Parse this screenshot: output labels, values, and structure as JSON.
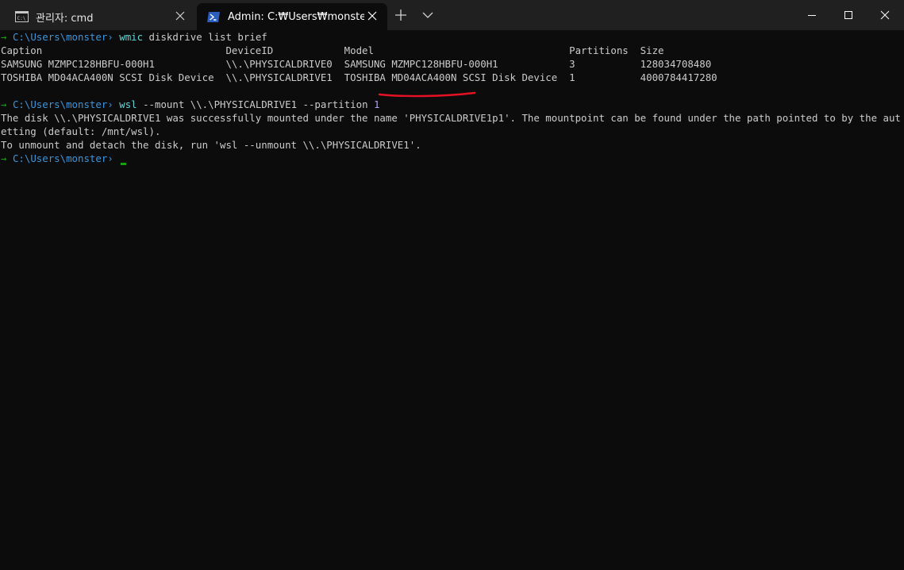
{
  "tabs": [
    {
      "title": "관리자: cmd",
      "icon": "cmd-icon",
      "active": false
    },
    {
      "title": "Admin: C:₩Users₩monster ~ P",
      "icon": "powershell-icon",
      "active": true
    }
  ],
  "window_buttons": {
    "minimize": "minimize-icon",
    "maximize": "maximize-icon",
    "close": "close-icon"
  },
  "terminal": {
    "prompt_path": "C:\\Users\\monster",
    "prompt_arrow": "→",
    "prompt_suffix": "›",
    "cmd1": {
      "program": "wmic",
      "args": " diskdrive list brief"
    },
    "table": {
      "headers": [
        "Caption",
        "DeviceID",
        "Model",
        "Partitions",
        "Size"
      ],
      "rows": [
        [
          "SAMSUNG MZMPC128HBFU-000H1",
          "\\\\.\\PHYSICALDRIVE0",
          "SAMSUNG MZMPC128HBFU-000H1",
          "3",
          "128034708480"
        ],
        [
          "TOSHIBA MD04ACA400N SCSI Disk Device",
          "\\\\.\\PHYSICALDRIVE1",
          "TOSHIBA MD04ACA400N SCSI Disk Device",
          "1",
          "4000784417280"
        ]
      ]
    },
    "cmd2": {
      "program": "wsl",
      "args": " --mount \\\\.\\PHYSICALDRIVE1 --partition ",
      "number": "1"
    },
    "output": [
      "The disk \\\\.\\PHYSICALDRIVE1 was successfully mounted under the name 'PHYSICALDRIVE1p1'. The mountpoint can be found under the path pointed to by the automount s",
      "etting (default: /mnt/wsl).",
      "To unmount and detach the disk, run 'wsl --unmount \\\\.\\PHYSICALDRIVE1'."
    ]
  },
  "colors": {
    "background": "#0c0c0c",
    "titlebar": "#202020",
    "prompt": "#3a96dd",
    "arrow": "#13a10e",
    "command": "#61d6d6",
    "annotation": "#e81123"
  }
}
